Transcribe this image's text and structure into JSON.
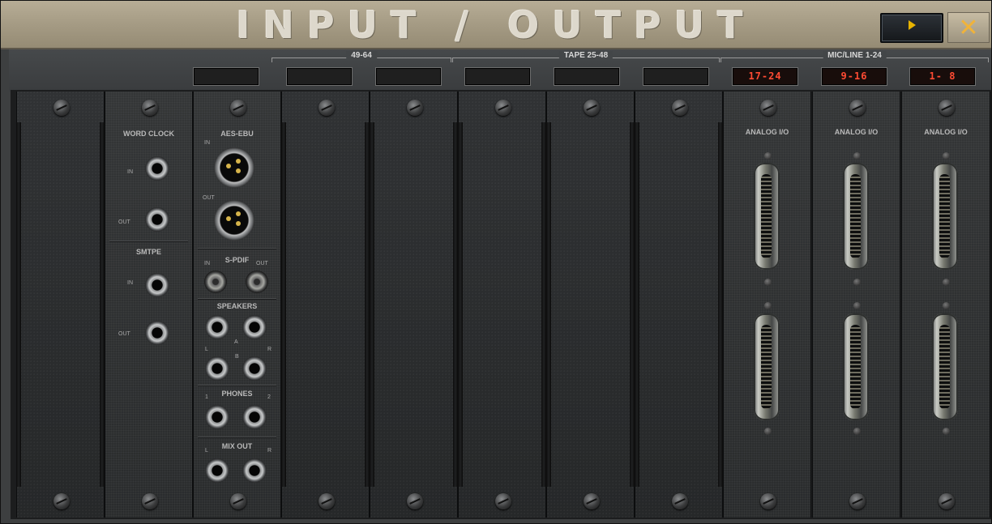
{
  "window": {
    "title": "INPUT / OUTPUT"
  },
  "toolbar": {
    "play_icon": "play-icon",
    "close_icon": "close-icon",
    "close_glyph": "✕"
  },
  "groups": [
    {
      "label": "49-64"
    },
    {
      "label": "TAPE 25-48"
    },
    {
      "label": "MIC/LINE 1-24"
    }
  ],
  "displays": [
    "",
    "",
    "",
    "",
    "",
    "",
    "17-24",
    "9-16",
    "1- 8"
  ],
  "modules": {
    "sync": {
      "word_clock": "WORD CLOCK",
      "smtpe": "SMTPE",
      "in": "IN",
      "out": "OUT"
    },
    "digital": {
      "aes_ebu": "AES-EBU",
      "spdif": "S-PDIF",
      "speakers": "SPEAKERS",
      "phones": "PHONES",
      "mix_out": "MIX OUT",
      "in": "IN",
      "out": "OUT",
      "a": "A",
      "b": "B",
      "l": "L",
      "r": "R",
      "one": "1",
      "two": "2"
    },
    "analog": {
      "label": "ANALOG I/O"
    }
  },
  "colors": {
    "display_text": "#ff4b33",
    "play_arrow": "#e7b300",
    "close_x": "#f0b33a",
    "title_panel": "#a59b84"
  }
}
